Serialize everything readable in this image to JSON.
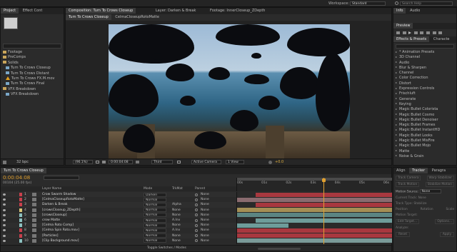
{
  "topbar": {
    "workspace_label": "Workspace:",
    "workspace_value": "Standard",
    "search_placeholder": "Search Help"
  },
  "project": {
    "tab_project": "Project",
    "tab_effect_controls": "Effect Cont",
    "items": [
      {
        "label": "Footage",
        "type": "folder"
      },
      {
        "label": "PreComps",
        "type": "folder"
      },
      {
        "label": "Solids",
        "type": "folder"
      },
      {
        "label": "Turn To Crows Closeup",
        "type": "comp"
      },
      {
        "label": "Turn To Crows Distant",
        "type": "comp"
      },
      {
        "label": "Turn To Crows FX.M.mov",
        "type": "warning"
      },
      {
        "label": "Turn To Crows Final",
        "type": "comp"
      },
      {
        "label": "VFX Breakdown",
        "type": "folder"
      },
      {
        "label": "VFX Breakdown",
        "type": "comp"
      }
    ],
    "bpc": "32 bpc"
  },
  "viewer": {
    "tab_composition": "Composition: Turn To Crows Closeup",
    "tab_layer": "Layer: Darken & Break",
    "tab_footage": "Footage: InnerCloseup_ZDepth",
    "subtab_1": "Turn To Crows Closeup",
    "subtab_2": "CelmaCloseupRotoMatte",
    "zoom": "(96.1%)",
    "timecode": "0:00:04:08",
    "resolution": "Third",
    "camera": "Active Camera",
    "views": "1 View",
    "exposure": "+0.0"
  },
  "info_panel": {
    "tab_info": "Info",
    "tab_audio": "Audio",
    "tab_preview": "Preview",
    "tab_effects": "Effects & Presets",
    "tab_character": "Characte",
    "effects": [
      "* Animation Presets",
      "3D Channel",
      "Audio",
      "Blur & Sharpen",
      "Channel",
      "Color Correction",
      "Distort",
      "Expression Controls",
      "Frischluft",
      "Generate",
      "Keying",
      "Magic Bullet Colorista",
      "Magic Bullet Cosmo",
      "Magic Bullet Denoiser",
      "Magic Bullet Frames",
      "Magic Bullet InstantHD",
      "Magic Bullet Looks",
      "Magic Bullet MisFire",
      "Magic Bullet Mojo",
      "Matte",
      "Noise & Grain"
    ]
  },
  "timeline": {
    "tab": "Turn To Crows Closeup",
    "timecode": "0:00:04:08",
    "frame_info": "00104 (25.00 fps)",
    "headers": {
      "layer_name": "Layer Name",
      "mode": "Mode",
      "trkmat": "TrkMat",
      "parent": "Parent"
    },
    "ruler": [
      "00s",
      "01s",
      "02s",
      "03s",
      "04s",
      "05s",
      "06s"
    ],
    "playhead_fraction": 0.56,
    "layers": [
      {
        "num": "1",
        "name": "Crow Swarm Shadow",
        "mode": "Darken",
        "trkmat": "",
        "parent": "None",
        "color": "#c8404c",
        "bar_start": 0.12,
        "bar_end": 1.0,
        "bar_color": "#a8383f"
      },
      {
        "num": "2",
        "name": "[CelmaCloseupRotoMatte]",
        "mode": "Normal",
        "trkmat": "",
        "parent": "None",
        "color": "#c8404c",
        "bar_start": 0.0,
        "bar_end": 1.0,
        "bar_color": "#8a6b6f"
      },
      {
        "num": "3",
        "name": "Darken & Break",
        "mode": "Normal",
        "trkmat": "Alpha",
        "parent": "None",
        "color": "#c8404c",
        "bar_start": 0.12,
        "bar_end": 1.0,
        "bar_color": "#a8383f"
      },
      {
        "num": "4",
        "name": "[crowsCloseup_ZDepth]",
        "mode": "Normal",
        "trkmat": "None",
        "parent": "None",
        "color": "#d8c478",
        "bar_start": 0.0,
        "bar_end": 1.0,
        "bar_color": "#a48f55"
      },
      {
        "num": "5",
        "name": "[crowsCloseup]",
        "mode": "Normal",
        "trkmat": "None",
        "parent": "None",
        "color": "#8cc1c0",
        "bar_start": 0.0,
        "bar_end": 1.0,
        "bar_color": "#5b8583"
      },
      {
        "num": "6",
        "name": "crow Matte",
        "mode": "Normal",
        "trkmat": "A.Inv",
        "parent": "None",
        "color": "#8cc1c0",
        "bar_start": 0.12,
        "bar_end": 1.0,
        "bar_color": "#6e9c9a"
      },
      {
        "num": "7",
        "name": "[Celma Roto Comp]",
        "mode": "Normal",
        "trkmat": "None",
        "parent": "None",
        "color": "#8cc1c0",
        "bar_start": 0.0,
        "bar_end": 0.33,
        "bar_color": "#6e9c9a"
      },
      {
        "num": "8",
        "name": "[Celma Spin Roto.mov]",
        "mode": "Normal",
        "trkmat": "A.Inv",
        "parent": "None",
        "color": "#c8404c",
        "bar_start": 0.0,
        "bar_end": 1.0,
        "bar_color": "#a8383f"
      },
      {
        "num": "9",
        "name": "[Particles]",
        "mode": "Normal",
        "trkmat": "None",
        "parent": "None",
        "color": "#c8404c",
        "bar_start": 0.0,
        "bar_end": 1.0,
        "bar_color": "#a8383f"
      },
      {
        "num": "10",
        "name": "[Clip Background.mov]",
        "mode": "Normal",
        "trkmat": "None",
        "parent": "None",
        "color": "#8cc1c0",
        "bar_start": 0.0,
        "bar_end": 1.0,
        "bar_color": "#7a9a98"
      }
    ],
    "toggle_label": "Toggle Switches / Modes"
  },
  "tracker": {
    "tab_align": "Align",
    "tab_tracker": "Tracker",
    "tab_paragraph": "Paragra",
    "btn_track_camera": "Track Camera",
    "btn_warp_stabilizer": "Warp Stabilizer",
    "btn_track_motion": "Track Motion",
    "btn_stabilize_motion": "Stabilize Motion",
    "motion_source_label": "Motion Source:",
    "motion_source_value": "None",
    "current_track_label": "Current Track:",
    "current_track_value": "None",
    "track_type_label": "Track Type:",
    "track_type_value": "Stabilize",
    "position_label": "Position",
    "rotation_label": "Rotation",
    "scale_label": "Scale",
    "motion_target_label": "Motion Target:",
    "edit_target": "Edit Target...",
    "options": "Options...",
    "analyze_label": "Analyze:",
    "reset": "Reset",
    "apply": "Apply"
  }
}
